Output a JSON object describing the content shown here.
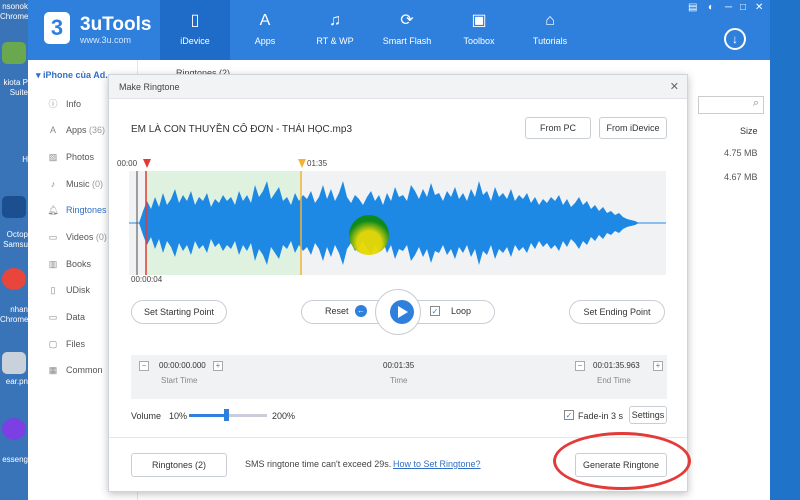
{
  "desktop": {
    "items": [
      "nsonok",
      "Chrome",
      "kiota P",
      "Suite",
      "H",
      "Octop",
      "Samsu",
      "nhan",
      "Chrome",
      "ear.pn",
      "esseng"
    ]
  },
  "app": {
    "brand": "3uTools",
    "url": "www.3u.com",
    "logo": "3"
  },
  "nav": [
    {
      "label": "iDevice",
      "icon": "phone-icon"
    },
    {
      "label": "Apps",
      "icon": "app-store-icon"
    },
    {
      "label": "RT & WP",
      "icon": "ringtone-icon"
    },
    {
      "label": "Smart Flash",
      "icon": "flash-icon"
    },
    {
      "label": "Toolbox",
      "icon": "toolbox-icon"
    },
    {
      "label": "Tutorials",
      "icon": "graduation-cap-icon"
    }
  ],
  "sidebar": {
    "device": "iPhone của Ad...",
    "items": [
      {
        "label": "Info",
        "icon": "info-icon"
      },
      {
        "label": "Apps",
        "count": "(36)",
        "icon": "apps-icon"
      },
      {
        "label": "Photos",
        "icon": "photos-icon"
      },
      {
        "label": "Music",
        "count": "(0)",
        "icon": "music-icon"
      },
      {
        "label": "Ringtones",
        "icon": "bell-icon"
      },
      {
        "label": "Videos",
        "count": "(0)",
        "icon": "video-icon"
      },
      {
        "label": "Books",
        "icon": "book-icon"
      },
      {
        "label": "UDisk",
        "icon": "udisk-icon"
      },
      {
        "label": "Data",
        "icon": "folder-icon"
      },
      {
        "label": "Files",
        "icon": "file-icon"
      },
      {
        "label": "Common",
        "icon": "grid-icon"
      }
    ]
  },
  "rightpane": {
    "tab": "Ringtones (2)",
    "size_header": "Size",
    "sizes": [
      "4.75 MB",
      "4.67 MB"
    ]
  },
  "dialog": {
    "title": "Make Ringtone",
    "song": "EM LÀ CON THUYỀN CÔ ĐƠN - THÁI HỌC.mp3",
    "from_pc": "From PC",
    "from_idevice": "From iDevice",
    "marker_start": "00:00",
    "marker_end": "01:35",
    "marker_bottom": "00:00:04",
    "set_start": "Set Starting Point",
    "reset": "Reset",
    "loop": "Loop",
    "set_end": "Set Ending Point",
    "start_time": "00:00:00.000",
    "start_label": "Start Time",
    "time": "00:01:35",
    "time_label": "Time",
    "end_time": "00:01:35.963",
    "end_label": "End Time",
    "volume_label": "Volume",
    "volume_min": "10%",
    "volume_max": "200%",
    "fade_in": "Fade-in 3 s",
    "settings": "Settings",
    "ringtones_btn": "Ringtones (2)",
    "sms_note": "SMS ringtone time can't exceed 29s.",
    "how_to": "How to Set Ringtone?",
    "generate": "Generate Ringtone"
  },
  "colors": {
    "top": "#2f80dd",
    "wave": "#1e88e5",
    "selection": "#dff2df",
    "start_marker": "#e53935",
    "end_marker": "#f2b233",
    "annotation": "#e33a3a"
  }
}
